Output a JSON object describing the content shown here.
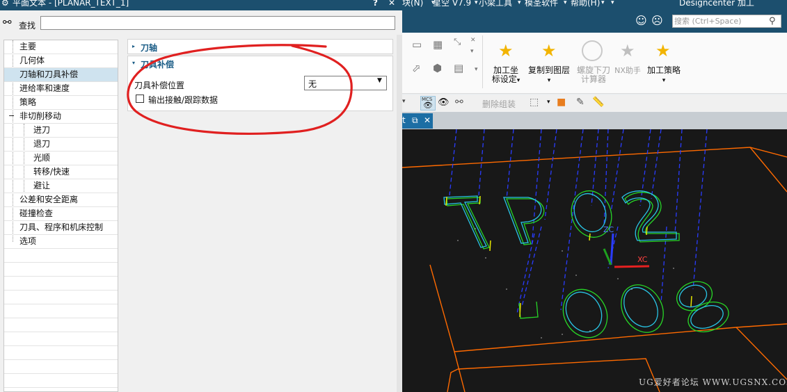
{
  "dialog": {
    "title": "平面文本 - [PLANAR_TEXT_1]",
    "help": "?",
    "close": "✕",
    "find_label": "查找",
    "find_value": "",
    "tree": [
      {
        "label": "主要",
        "level": 0
      },
      {
        "label": "几何体",
        "level": 0
      },
      {
        "label": "刀轴和刀具补偿",
        "level": 0,
        "selected": true
      },
      {
        "label": "进给率和速度",
        "level": 0
      },
      {
        "label": "策略",
        "level": 0
      },
      {
        "label": "非切削移动",
        "level": 0,
        "expander": "−"
      },
      {
        "label": "进刀",
        "level": 1
      },
      {
        "label": "退刀",
        "level": 1
      },
      {
        "label": "光顺",
        "level": 1
      },
      {
        "label": "转移/快速",
        "level": 1
      },
      {
        "label": "避让",
        "level": 1
      },
      {
        "label": "公差和安全距离",
        "level": 0
      },
      {
        "label": "碰撞检查",
        "level": 0
      },
      {
        "label": "刀具、程序和机床控制",
        "level": 0
      },
      {
        "label": "选项",
        "level": 0
      }
    ],
    "group_axis": {
      "title": "刀轴",
      "arrow": "▸"
    },
    "group_comp": {
      "title": "刀具补偿",
      "arrow": "▾",
      "position_label": "刀具补偿位置",
      "position_value": "无",
      "checkbox_label": "输出接触/跟踪数据",
      "checkbox_checked": false
    }
  },
  "nx": {
    "menu": [
      "块(N)",
      "▾",
      "星空 V7.9",
      "▾",
      "小梁工具",
      "▾",
      "模圣软件",
      "▾",
      "帮助(H)",
      "▾",
      "▾"
    ],
    "app_title": "Designcenter 加工",
    "search_placeholder": "搜索 (Ctrl+Space)",
    "ribbon_buttons": [
      {
        "label1": "加工坐",
        "label2": "标设定",
        "dropdown": "▾",
        "disabled": false
      },
      {
        "label1": "复制到图层",
        "label2": "▾",
        "dropdown": "",
        "disabled": false
      },
      {
        "label1": "螺旋下刀",
        "label2": "计算器",
        "dropdown": "",
        "disabled": true
      },
      {
        "label1": "NX助手",
        "label2": "",
        "dropdown": "",
        "disabled": true
      },
      {
        "label1": "加工策略",
        "label2": "▾",
        "dropdown": "",
        "disabled": false
      }
    ],
    "toolbar2": {
      "mcs": "MCS",
      "disassemble": "删除组装"
    },
    "tab_label": "t",
    "viewport": {
      "zc_label": "ZC",
      "xc_label": "XC",
      "chars_top": [
        "T",
        "P",
        "0",
        "2"
      ],
      "chars_bottom": [
        "0",
        "0",
        "8"
      ]
    },
    "watermark": "UG爱好者论坛 WWW.UGSNX.COM"
  },
  "colors": {
    "titlebar": "#1c4f6e",
    "accent_text": "#1a5c86",
    "annotation": "#e02020",
    "outline": "#ff6a00",
    "toolpath": "#2a3cff"
  }
}
